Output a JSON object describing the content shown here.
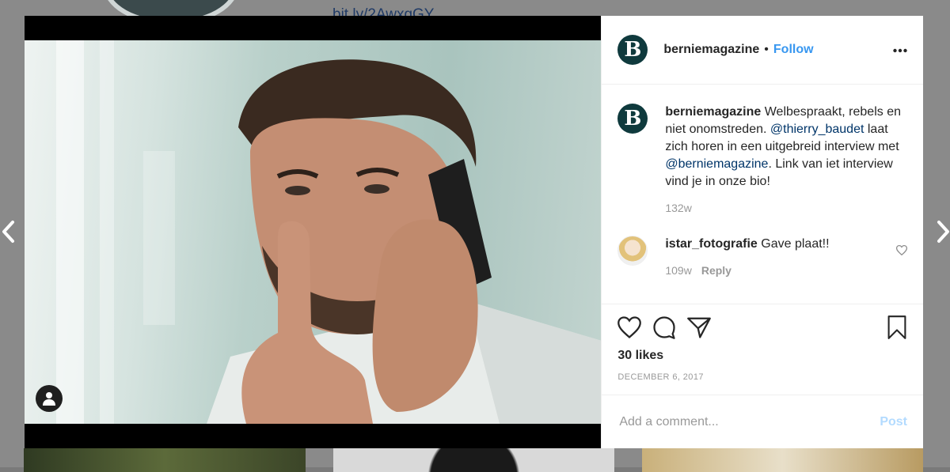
{
  "background": {
    "link_text": "bit.ly/2AwxgGY"
  },
  "post": {
    "author": {
      "username": "berniemagazine",
      "avatar_letter": "B",
      "follow_label": "Follow",
      "separator": "•"
    },
    "caption": {
      "username": "berniemagazine",
      "text_1": " Welbespraakt, rebels en niet onomstreden. ",
      "mention_1": "@thierry_baudet",
      "text_2": " laat zich horen in een uitgebreid interview met ",
      "mention_2": "@berniemagazine",
      "text_3": ". Link van iet interview vind je in onze bio!",
      "time": "132w"
    },
    "comments": [
      {
        "username": "istar_fotografie",
        "text": " Gave plaat!!",
        "time": "109w",
        "reply_label": "Reply"
      }
    ],
    "likes": "30 likes",
    "date": "December 6, 2017",
    "add_comment": {
      "placeholder": "Add a comment...",
      "post_label": "Post"
    }
  },
  "icons": {
    "more": "more-options-icon",
    "like": "heart-icon",
    "comment": "comment-icon",
    "share": "share-icon",
    "save": "bookmark-icon",
    "user_tag": "user-tag-icon",
    "prev": "chevron-left-icon",
    "next": "chevron-right-icon"
  },
  "colors": {
    "accent": "#3897f0",
    "mention": "#003569",
    "brand_avatar": "#0f3a3d"
  }
}
